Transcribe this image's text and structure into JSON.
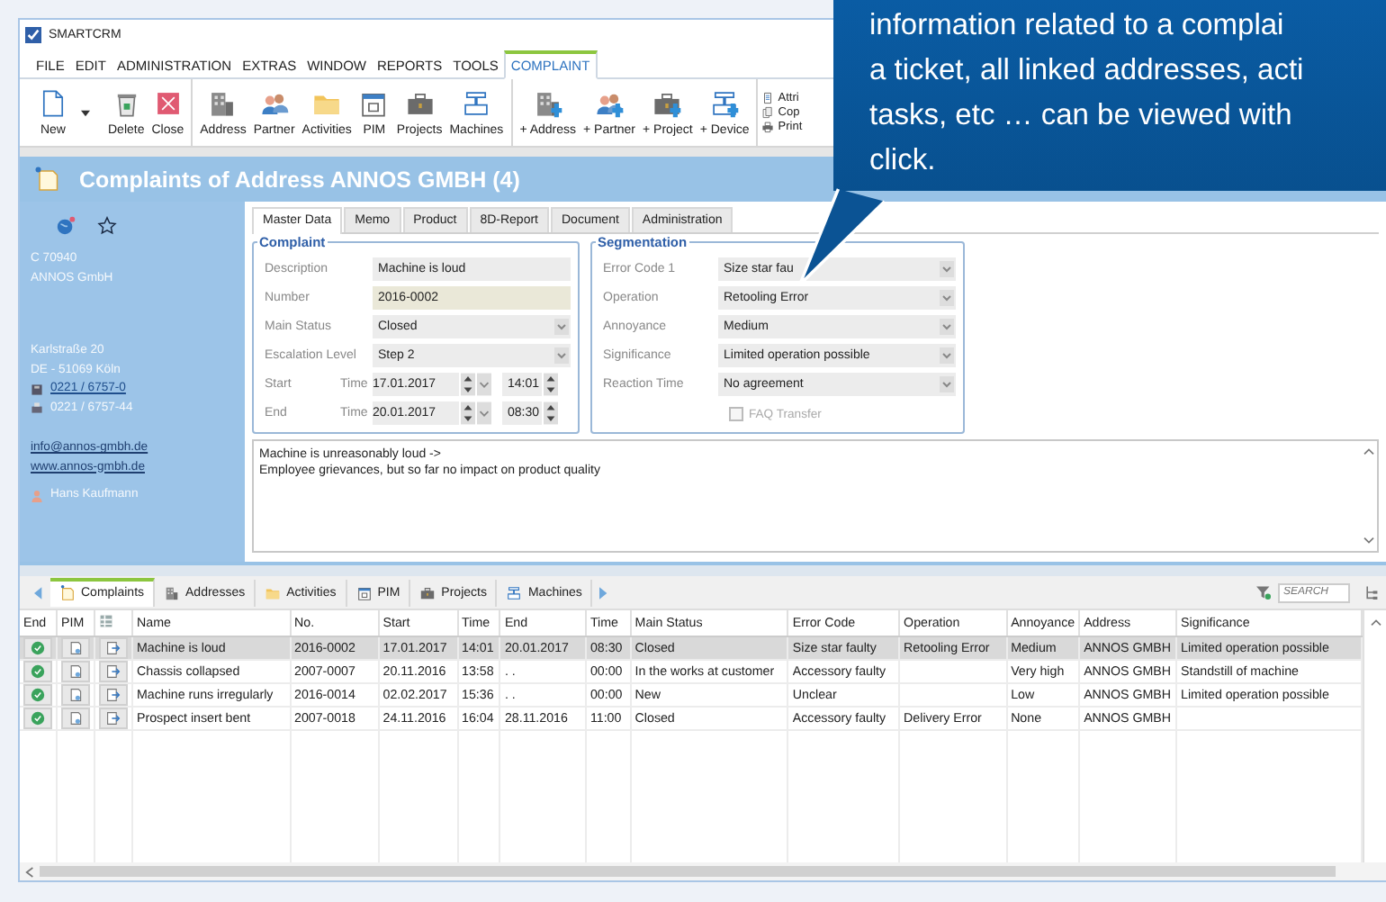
{
  "window": {
    "title": "SMARTCRM"
  },
  "menu": [
    {
      "label": "FILE",
      "selected": false
    },
    {
      "label": "EDIT",
      "selected": false
    },
    {
      "label": "ADMINISTRATION",
      "selected": false
    },
    {
      "label": "EXTRAS",
      "selected": false
    },
    {
      "label": "WINDOW",
      "selected": false
    },
    {
      "label": "REPORTS",
      "selected": false
    },
    {
      "label": "TOOLS",
      "selected": false
    },
    {
      "label": "COMPLAINT",
      "selected": true
    }
  ],
  "ribbon": {
    "groups": [
      [
        {
          "label": "New",
          "dropdown": true
        },
        {
          "label": "Delete"
        },
        {
          "label": "Close"
        }
      ],
      [
        {
          "label": "Address"
        },
        {
          "label": "Partner"
        },
        {
          "label": "Activities"
        },
        {
          "label": "PIM"
        },
        {
          "label": "Projects"
        },
        {
          "label": "Machines"
        }
      ],
      [
        {
          "label": "+ Address"
        },
        {
          "label": "+ Partner"
        },
        {
          "label": "+ Project"
        },
        {
          "label": "+ Device"
        }
      ]
    ],
    "small_items": [
      {
        "label": "Attri"
      },
      {
        "label": "Cop"
      },
      {
        "label": "Print"
      }
    ]
  },
  "header": {
    "title": "Complaints of Address ANNOS GMBH (4)"
  },
  "address_panel": {
    "customer_no": "C 70940",
    "company": "ANNOS GmbH",
    "street": "Karlstraße 20",
    "city": "DE - 51069 Köln",
    "phone": "0221 / 6757-0",
    "fax": "0221 / 6757-44",
    "email": "info@annos-gmbh.de",
    "web": "www.annos-gmbh.de",
    "contact": "Hans Kaufmann"
  },
  "detail_tabs": [
    {
      "label": "Master Data",
      "selected": true
    },
    {
      "label": "Memo",
      "selected": false
    },
    {
      "label": "Product",
      "selected": false
    },
    {
      "label": "8D-Report",
      "selected": false
    },
    {
      "label": "Document",
      "selected": false
    },
    {
      "label": "Administration",
      "selected": false
    }
  ],
  "complaint": {
    "legend": "Complaint",
    "fields": [
      {
        "kind": "text",
        "label": "Description",
        "value": "Machine is loud"
      },
      {
        "kind": "readonly",
        "label": "Number",
        "value": "2016-0002"
      },
      {
        "kind": "select",
        "label": "Main Status",
        "value": "Closed"
      },
      {
        "kind": "select",
        "label": "Escalation Level",
        "value": "Step 2"
      },
      {
        "kind": "datetime",
        "label": "Start",
        "time_label": "Time",
        "date": "17.01.2017",
        "time": "14:01"
      },
      {
        "kind": "datetime",
        "label": "End",
        "time_label": "Time",
        "date": "20.01.2017",
        "time": "08:30"
      }
    ]
  },
  "segmentation": {
    "legend": "Segmentation",
    "fields": [
      {
        "label": "Error Code 1",
        "value": "Size star fau"
      },
      {
        "label": "Operation",
        "value": "Retooling Error"
      },
      {
        "label": "Annoyance",
        "value": "Medium"
      },
      {
        "label": "Significance",
        "value": "Limited operation possible"
      },
      {
        "label": "Reaction Time",
        "value": "No agreement"
      }
    ],
    "faq_transfer": {
      "label": "FAQ Transfer",
      "checked": false,
      "disabled": true
    }
  },
  "memo": [
    "Machine is unreasonably loud ->",
    "Employee grievances, but so far no impact on product quality"
  ],
  "list_tabs": [
    {
      "label": "Complaints",
      "selected": true
    },
    {
      "label": "Addresses",
      "selected": false
    },
    {
      "label": "Activities",
      "selected": false
    },
    {
      "label": "PIM",
      "selected": false
    },
    {
      "label": "Projects",
      "selected": false
    },
    {
      "label": "Machines",
      "selected": false
    }
  ],
  "search": {
    "placeholder": "SEARCH"
  },
  "table": {
    "columns": [
      "End",
      "PIM",
      "",
      "Name",
      "No.",
      "Start",
      "Time",
      "End",
      "Time",
      "Main Status",
      "Error Code",
      "Operation",
      "Annoyance",
      "Address",
      "Significance"
    ],
    "rows": [
      {
        "selected": true,
        "cells": [
          "",
          "",
          "",
          "Machine is loud",
          "2016-0002",
          "17.01.2017",
          "14:01",
          "20.01.2017",
          "08:30",
          "Closed",
          "Size star faulty",
          "Retooling Error",
          "Medium",
          "ANNOS GMBH",
          "Limited operation possible"
        ]
      },
      {
        "selected": false,
        "cells": [
          "",
          "",
          "",
          "Chassis collapsed",
          "2007-0007",
          "20.11.2016",
          "13:58",
          ". .",
          "00:00",
          "In the works at customer",
          "Accessory faulty",
          "",
          "Very high",
          "ANNOS GMBH",
          "Standstill of machine"
        ]
      },
      {
        "selected": false,
        "cells": [
          "",
          "",
          "",
          "Machine runs irregularly",
          "2016-0014",
          "02.02.2017",
          "15:36",
          ". .",
          "00:00",
          "New",
          "Unclear",
          "",
          "Low",
          "ANNOS GMBH",
          "Limited operation possible"
        ]
      },
      {
        "selected": false,
        "cells": [
          "",
          "",
          "",
          "Prospect insert bent",
          "2007-0018",
          "24.11.2016",
          "16:04",
          "28.11.2016",
          "11:00",
          "Closed",
          "Accessory faulty",
          "Delivery Error",
          "None",
          "ANNOS GMBH",
          ""
        ]
      }
    ]
  },
  "callout": {
    "lines": [
      "information related to a complai",
      "a ticket, all linked addresses, acti",
      "tasks, etc … can be viewed with",
      "click."
    ]
  }
}
